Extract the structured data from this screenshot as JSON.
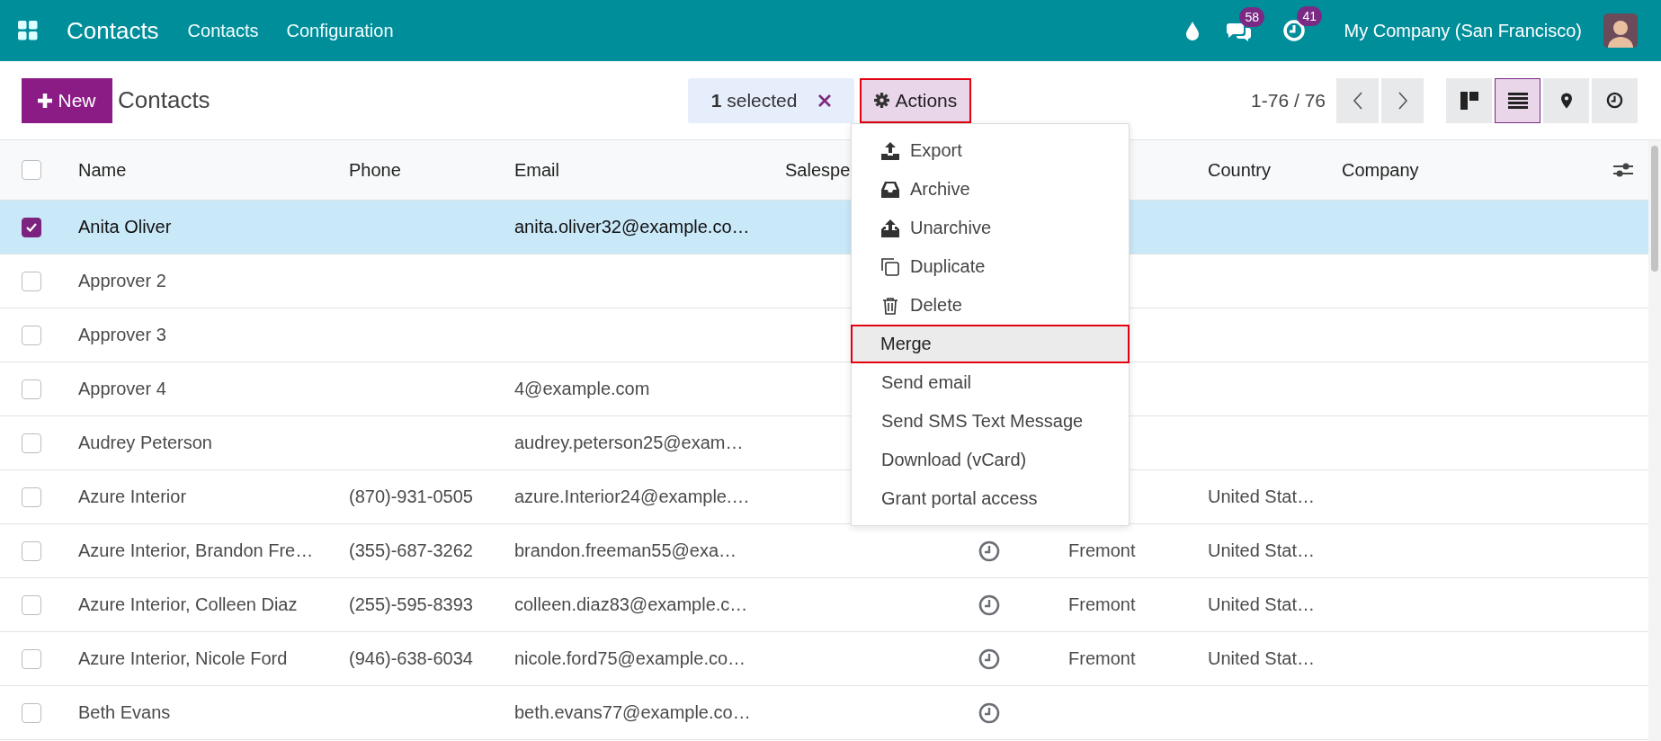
{
  "navbar": {
    "app_name": "Contacts",
    "menu": [
      "Contacts",
      "Configuration"
    ],
    "messages_badge": "58",
    "activities_badge": "41",
    "company": "My Company (San Francisco)"
  },
  "control_panel": {
    "new_button": "New",
    "title": "Contacts",
    "selection": "**1** selected",
    "actions_button": {
      "label": "Actions",
      "highlighted": true
    },
    "pager": "1-76 / 76",
    "views": [
      {
        "kind": "kanban",
        "selected": false
      },
      {
        "kind": "list",
        "selected": true
      },
      {
        "kind": "map",
        "selected": false
      },
      {
        "kind": "activity",
        "selected": false
      }
    ]
  },
  "actions_menu": {
    "items": [
      {
        "label": "Export",
        "kind": "export",
        "highlighted": false
      },
      {
        "label": "Archive",
        "kind": "archive",
        "highlighted": false
      },
      {
        "label": "Unarchive",
        "kind": "unarchive",
        "highlighted": false
      },
      {
        "label": "Duplicate",
        "kind": "duplicate",
        "highlighted": false
      },
      {
        "label": "Delete",
        "kind": "delete",
        "highlighted": false
      },
      {
        "label": "Merge",
        "kind": "plain",
        "highlighted": true
      },
      {
        "label": "Send email",
        "kind": "plain",
        "highlighted": false
      },
      {
        "label": "Send SMS Text Message",
        "kind": "plain",
        "highlighted": false
      },
      {
        "label": "Download (vCard)",
        "kind": "plain",
        "highlighted": false
      },
      {
        "label": "Grant portal access",
        "kind": "plain",
        "highlighted": false
      }
    ]
  },
  "table": {
    "header_checked": false,
    "columns": [
      "Name",
      "Phone",
      "Email",
      "Salespe",
      "Country",
      "Company"
    ],
    "rows": [
      {
        "checked": true,
        "selected": true,
        "name": "Anita Oliver",
        "email": "anita.oliver32@example.co…",
        "activity_icon": false
      },
      {
        "checked": false,
        "selected": false,
        "name": "Approver 2",
        "activity_icon": false
      },
      {
        "checked": false,
        "selected": false,
        "name": "Approver 3",
        "activity_icon": false
      },
      {
        "checked": false,
        "selected": false,
        "name": "Approver 4",
        "email": "4@example.com",
        "activity_icon": false
      },
      {
        "checked": false,
        "selected": false,
        "name": "Audrey Peterson",
        "email": "audrey.peterson25@exam…",
        "activity_icon": false
      },
      {
        "checked": false,
        "selected": false,
        "name": "Azure Interior",
        "phone": "(870)-931-0505",
        "email": "azure.Interior24@example.…",
        "activity_icon": false,
        "country": "United Stat…"
      },
      {
        "checked": false,
        "selected": false,
        "name": "Azure Interior, Brandon Fre…",
        "phone": "(355)-687-3262",
        "email": "brandon.freeman55@exa…",
        "activity_icon": true,
        "city": "Fremont",
        "country": "United Stat…"
      },
      {
        "checked": false,
        "selected": false,
        "name": "Azure Interior, Colleen Diaz",
        "phone": "(255)-595-8393",
        "email": "colleen.diaz83@example.c…",
        "activity_icon": true,
        "city": "Fremont",
        "country": "United Stat…"
      },
      {
        "checked": false,
        "selected": false,
        "name": "Azure Interior, Nicole Ford",
        "phone": "(946)-638-6034",
        "email": "nicole.ford75@example.co…",
        "activity_icon": true,
        "city": "Fremont",
        "country": "United Stat…"
      },
      {
        "checked": false,
        "selected": false,
        "name": "Beth Evans",
        "email": "beth.evans77@example.co…",
        "activity_icon": true
      }
    ]
  }
}
